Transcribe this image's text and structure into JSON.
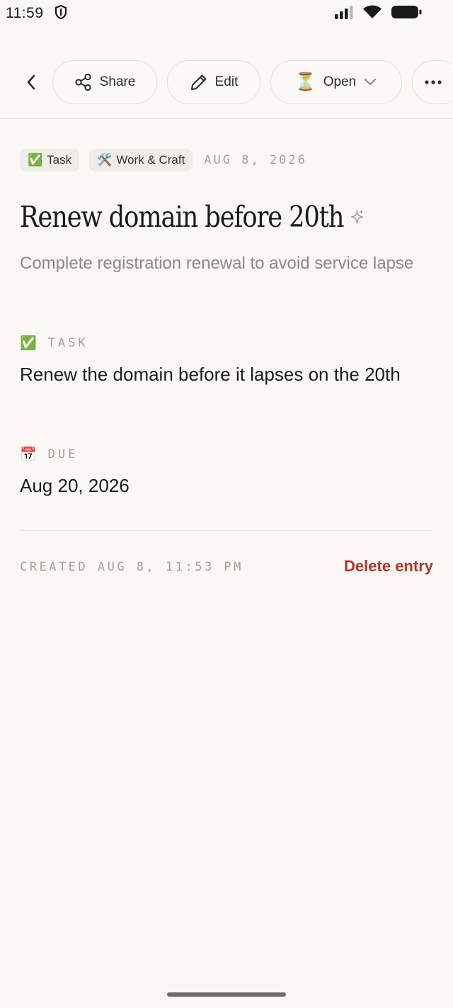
{
  "status_bar": {
    "time": "11:59"
  },
  "toolbar": {
    "share_label": "Share",
    "edit_label": "Edit",
    "open_label": "Open",
    "open_emoji": "⏳"
  },
  "entry": {
    "tags": [
      {
        "emoji": "✅",
        "label": "Task"
      },
      {
        "emoji": "🛠️",
        "label": "Work & Craft"
      }
    ],
    "date": "AUG 8, 2026",
    "title": "Renew domain before 20th",
    "subtitle": "Complete registration renewal to avoid service lapse",
    "sections": [
      {
        "emoji": "✅",
        "label": "TASK",
        "value": "Renew the domain before it lapses on the 20th"
      },
      {
        "emoji": "📅",
        "label": "DUE",
        "value": "Aug 20, 2026"
      }
    ],
    "created": "CREATED AUG 8, 11:53 PM",
    "delete_label": "Delete entry"
  },
  "colors": {
    "background": "#f9f8f4",
    "delete": "#b2352a",
    "muted": "#a3a19c"
  }
}
